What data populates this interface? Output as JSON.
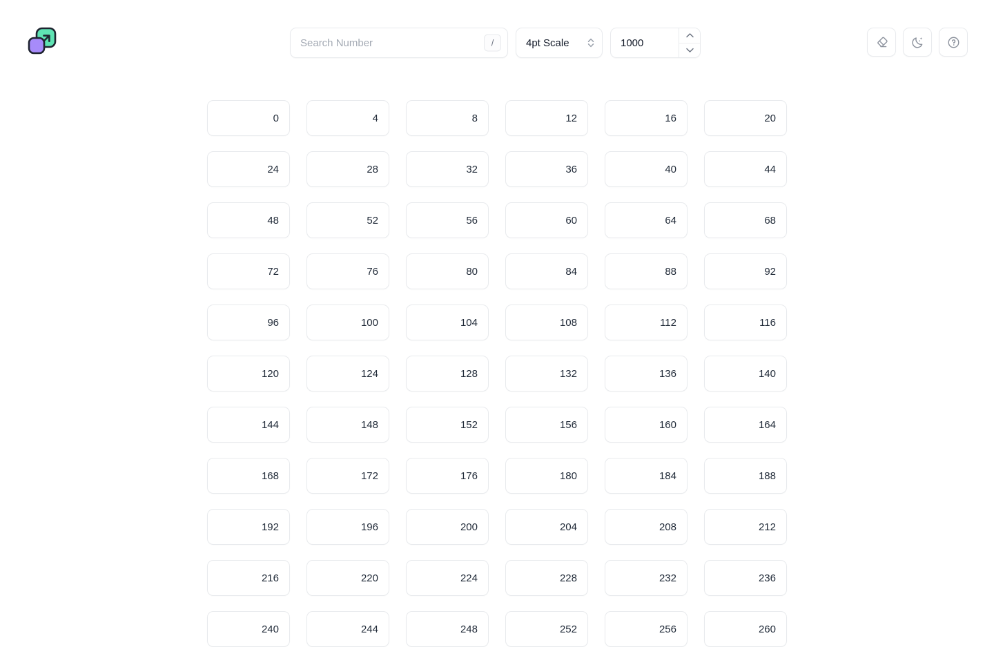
{
  "app": {
    "logo_icon": "resize-arrow-squares-logo",
    "background_color": "#ffffff",
    "accent_teal": "#5fe3b3",
    "accent_purple": "#a78bfa",
    "border_color": "#e8eaed"
  },
  "header": {
    "search": {
      "placeholder": "Search Number",
      "value": "",
      "shortcut_key": "/",
      "icon": "search-input"
    },
    "scale_select": {
      "selected": "4pt Scale",
      "icon": "chevron-up-down-icon",
      "options": [
        "4pt Scale"
      ]
    },
    "max_number": {
      "value": "1000",
      "increment_icon": "chevron-up-icon",
      "decrement_icon": "chevron-down-icon"
    },
    "actions": [
      {
        "name": "eraser-button",
        "icon": "eraser-icon",
        "label": "Clear"
      },
      {
        "name": "dark-mode-button",
        "icon": "moon-stars-icon",
        "label": "Dark mode"
      },
      {
        "name": "help-button",
        "icon": "question-circle-icon",
        "label": "Help"
      }
    ]
  },
  "grid": {
    "columns": 6,
    "step": 4,
    "numbers": [
      "0",
      "4",
      "8",
      "12",
      "16",
      "20",
      "24",
      "28",
      "32",
      "36",
      "40",
      "44",
      "48",
      "52",
      "56",
      "60",
      "64",
      "68",
      "72",
      "76",
      "80",
      "84",
      "88",
      "92",
      "96",
      "100",
      "104",
      "108",
      "112",
      "116",
      "120",
      "124",
      "128",
      "132",
      "136",
      "140",
      "144",
      "148",
      "152",
      "156",
      "160",
      "164",
      "168",
      "172",
      "176",
      "180",
      "184",
      "188",
      "192",
      "196",
      "200",
      "204",
      "208",
      "212",
      "216",
      "220",
      "224",
      "228",
      "232",
      "236",
      "240",
      "244",
      "248",
      "252",
      "256",
      "260"
    ]
  }
}
